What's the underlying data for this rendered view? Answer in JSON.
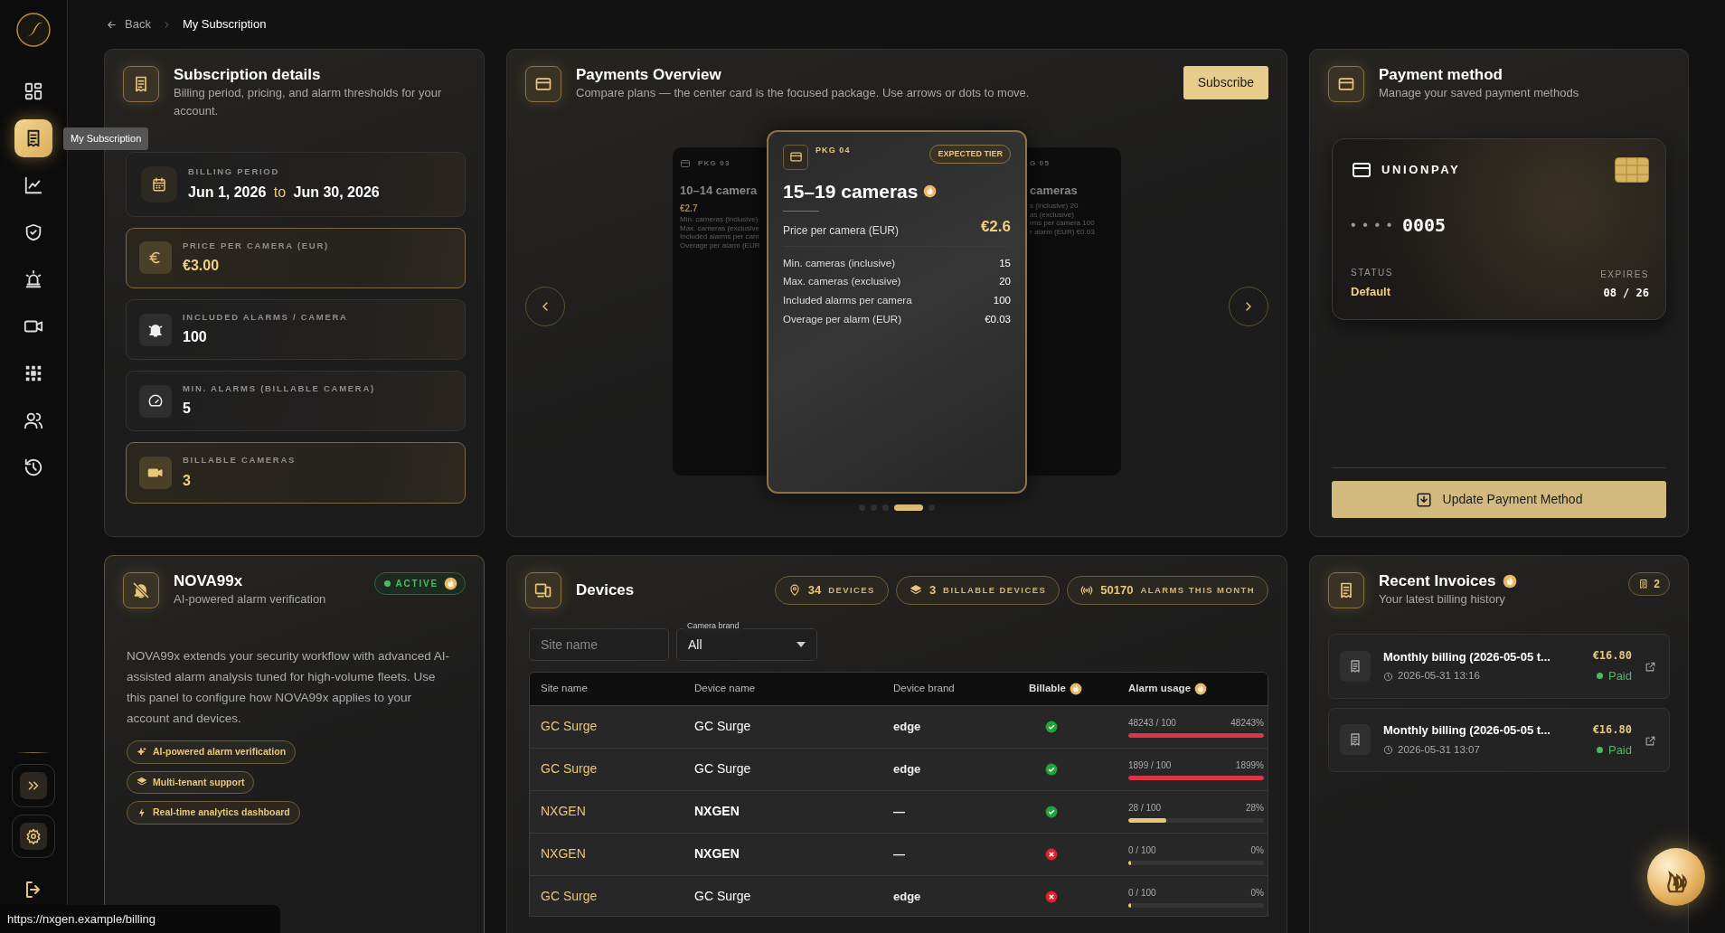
{
  "sidebar": {
    "items": [
      {
        "selected": false
      },
      {
        "selected": true,
        "tooltip": "My Subscription"
      },
      {
        "selected": false
      },
      {
        "selected": false
      },
      {
        "selected": false
      },
      {
        "selected": false
      },
      {
        "selected": false
      },
      {
        "selected": false
      },
      {
        "selected": false
      }
    ]
  },
  "breadcrumb": {
    "back": "Back",
    "current": "My Subscription"
  },
  "subscription": {
    "title": "Subscription details",
    "subtitle": "Billing period, pricing, and alarm thresholds for your account.",
    "items": [
      {
        "kind": "period",
        "label": "BILLING PERIOD",
        "from": "Jun 1, 2026",
        "joiner": "to",
        "to": "Jun 30, 2026",
        "highlighted": false
      },
      {
        "kind": "value",
        "label": "PRICE PER CAMERA (EUR)",
        "value": "€3.00",
        "highlighted": true
      },
      {
        "kind": "value",
        "label": "INCLUDED ALARMS / CAMERA",
        "value": "100",
        "highlighted": false
      },
      {
        "kind": "value",
        "label": "MIN. ALARMS (BILLABLE CAMERA)",
        "value": "5",
        "highlighted": false
      },
      {
        "kind": "value",
        "label": "BILLABLE CAMERAS",
        "value": "3",
        "highlighted": true
      }
    ]
  },
  "payments": {
    "title": "Payments Overview",
    "subtitle": "Compare plans — the center card is the focused package. Use arrows or dots to move.",
    "subscribe": "Subscribe",
    "previous": {
      "tag": "PKG 03",
      "title": "10–14 camera",
      "price": "€2.7",
      "lines": [
        "Min. cameras (inclusive)",
        "Max. cameras (exclusive",
        "Included alarms per cam",
        "Overage per alarm (EUR"
      ]
    },
    "focused": {
      "tag": "PKG 04",
      "badge": "EXPECTED TIER",
      "title": "15–19 cameras",
      "price_label": "Price per camera (EUR)",
      "price": "€2.6",
      "rows": [
        {
          "label": "Min. cameras (inclusive)",
          "value": "15"
        },
        {
          "label": "Max. cameras (exclusive)",
          "value": "20"
        },
        {
          "label": "Included alarms per camera",
          "value": "100"
        },
        {
          "label": "Overage per alarm (EUR)",
          "value": "€0.03"
        }
      ]
    },
    "next": {
      "tag": "G 05",
      "title": "cameras",
      "lines": [
        "s (inclusive) 20",
        "as (exclusive)",
        "rms per camera 100",
        "r alarm (EUR) €0.03"
      ]
    },
    "dots": [
      {
        "selected": false
      },
      {
        "selected": false
      },
      {
        "selected": false
      },
      {
        "selected": true
      },
      {
        "selected": false
      }
    ]
  },
  "payment_method": {
    "title": "Payment method",
    "subtitle": "Manage your saved payment methods",
    "card": {
      "brand": "UNIONPAY",
      "masked": "• • • •",
      "last4": "0005",
      "status_label": "STATUS",
      "status": "Default",
      "expires_label": "EXPIRES",
      "expires": "08 / 26"
    },
    "button": "Update Payment Method"
  },
  "nova": {
    "title": "NOVA99x",
    "subtitle": "AI-powered alarm verification",
    "status": {
      "label": "ACTIVE",
      "active": true
    },
    "description": "NOVA99x extends your security workflow with advanced AI-assisted alarm analysis tuned for high-volume fleets. Use this panel to configure how NOVA99x applies to your account and devices.",
    "features": [
      "AI-powered alarm verification",
      "Multi-tenant support",
      "Real-time analytics dashboard"
    ]
  },
  "devices": {
    "title": "Devices",
    "stats": [
      {
        "value": "34",
        "label": "DEVICES"
      },
      {
        "value": "3",
        "label": "BILLABLE DEVICES"
      },
      {
        "value": "50170",
        "label": "ALARMS THIS MONTH"
      }
    ],
    "filters": {
      "site": {
        "placeholder": "Site name"
      },
      "brand": {
        "label": "Camera brand",
        "value": "All"
      }
    },
    "columns": [
      "Site name",
      "Device name",
      "Device brand",
      "Billable",
      "Alarm usage"
    ],
    "rows": [
      {
        "site": "GC Surge",
        "device": "GC Surge",
        "device_bold": false,
        "brand": "edge",
        "billable": true,
        "usage": "48243 / 100",
        "percent": "48243%",
        "level": 1,
        "color": "#dc3545"
      },
      {
        "site": "GC Surge",
        "device": "GC Surge",
        "device_bold": false,
        "brand": "edge",
        "billable": true,
        "usage": "1899 / 100",
        "percent": "1899%",
        "level": 1,
        "color": "#dc3545"
      },
      {
        "site": "NXGEN",
        "device": "NXGEN",
        "device_bold": true,
        "brand": "—",
        "billable": true,
        "usage": "28 / 100",
        "percent": "28%",
        "level": 0.28,
        "color": "#e8c77a"
      },
      {
        "site": "NXGEN",
        "device": "NXGEN",
        "device_bold": true,
        "brand": "—",
        "billable": false,
        "usage": "0 / 100",
        "percent": "0%",
        "level": 0
      },
      {
        "site": "GC Surge",
        "device": "GC Surge",
        "device_bold": false,
        "brand": "edge",
        "billable": false,
        "usage": "0 / 100",
        "percent": "0%",
        "level": 0
      }
    ]
  },
  "invoices": {
    "title": "Recent Invoices",
    "subtitle": "Your latest billing history",
    "count": "2",
    "items": [
      {
        "title": "Monthly billing (2026-05-05 t...",
        "time": "2026-05-31 13:16",
        "amount": "€16.80",
        "status": "Paid",
        "paid": true
      },
      {
        "title": "Monthly billing (2026-05-05 t...",
        "time": "2026-05-31 13:07",
        "amount": "€16.80",
        "status": "Paid",
        "paid": true
      }
    ]
  },
  "status_bar": {
    "url": "https://nxgen.example/billing"
  }
}
